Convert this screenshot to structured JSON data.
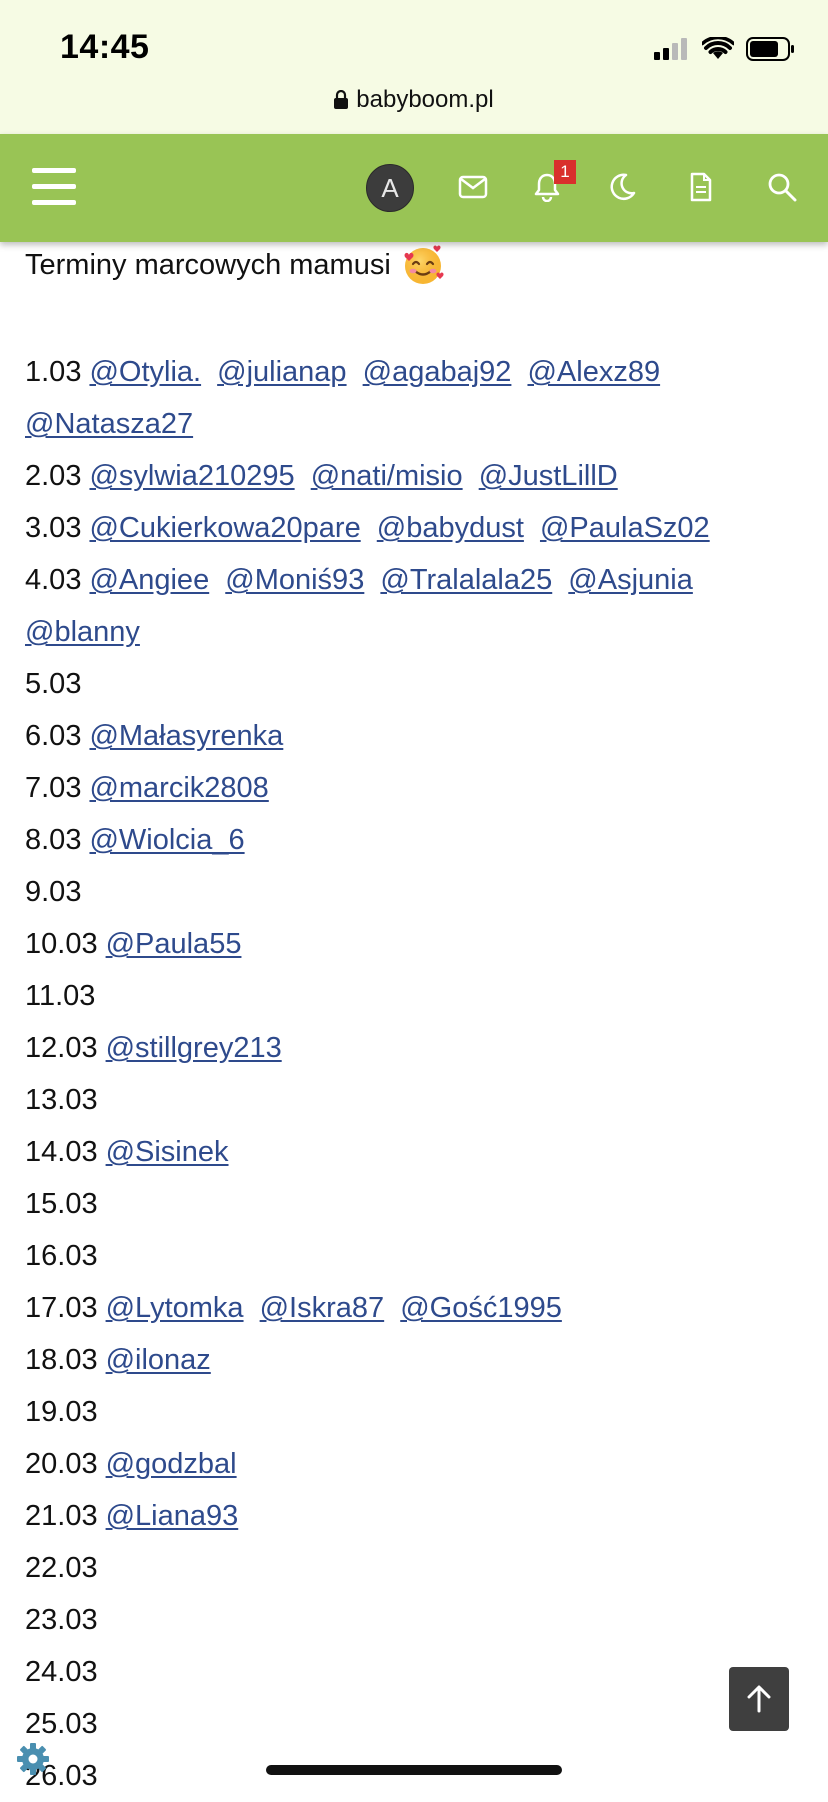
{
  "status_bar": {
    "time": "14:45",
    "url": "babyboom.pl",
    "icons": [
      "signal-icon",
      "wifi-icon",
      "battery-icon",
      "lock-icon"
    ]
  },
  "nav": {
    "avatar_letter": "A",
    "notification_count": "1",
    "background_color": "#99c455",
    "icons": [
      "menu-icon",
      "mail-icon",
      "bell-icon",
      "moon-icon",
      "document-icon",
      "search-icon"
    ]
  },
  "post": {
    "title": "Terminy marcowych mamusi",
    "title_emoji": "smiling-face-with-hearts-icon",
    "entries": [
      {
        "date": "1.03",
        "mentions": [
          "@Otylia.",
          "@julianap",
          "@agabaj92",
          "@Alexz89",
          "@Natasza27"
        ]
      },
      {
        "date": "2.03",
        "mentions": [
          "@sylwia210295",
          "@nati/misio",
          "@JustLillD"
        ]
      },
      {
        "date": "3.03",
        "mentions": [
          "@Cukierkowa20pare",
          "@babydust",
          "@PaulaSz02"
        ]
      },
      {
        "date": "4.03",
        "mentions": [
          "@Angiee",
          "@Moniś93",
          "@Tralalala25",
          "@Asjunia",
          "@blanny"
        ]
      },
      {
        "date": "5.03",
        "mentions": []
      },
      {
        "date": "6.03",
        "mentions": [
          "@Małasyrenka"
        ]
      },
      {
        "date": "7.03",
        "mentions": [
          "@marcik2808"
        ]
      },
      {
        "date": "8.03",
        "mentions": [
          "@Wiolcia_6"
        ]
      },
      {
        "date": "9.03",
        "mentions": []
      },
      {
        "date": "10.03",
        "mentions": [
          "@Paula55"
        ]
      },
      {
        "date": "11.03",
        "mentions": []
      },
      {
        "date": "12.03",
        "mentions": [
          "@stillgrey213"
        ]
      },
      {
        "date": "13.03",
        "mentions": []
      },
      {
        "date": "14.03",
        "mentions": [
          "@Sisinek"
        ]
      },
      {
        "date": "15.03",
        "mentions": []
      },
      {
        "date": "16.03",
        "mentions": []
      },
      {
        "date": "17.03",
        "mentions": [
          "@Lytomka",
          "@Iskra87",
          "@Gość1995"
        ]
      },
      {
        "date": "18.03",
        "mentions": [
          "@ilonaz"
        ]
      },
      {
        "date": "19.03",
        "mentions": []
      },
      {
        "date": "20.03",
        "mentions": [
          "@godzbal"
        ]
      },
      {
        "date": "21.03",
        "mentions": [
          "@Liana93"
        ]
      },
      {
        "date": "22.03",
        "mentions": []
      },
      {
        "date": "23.03",
        "mentions": []
      },
      {
        "date": "24.03",
        "mentions": []
      },
      {
        "date": "25.03",
        "mentions": []
      },
      {
        "date": "26.03",
        "mentions": []
      }
    ]
  },
  "controls": {
    "scroll_top_icon": "arrow-up-icon",
    "settings_icon": "gear-icon"
  }
}
